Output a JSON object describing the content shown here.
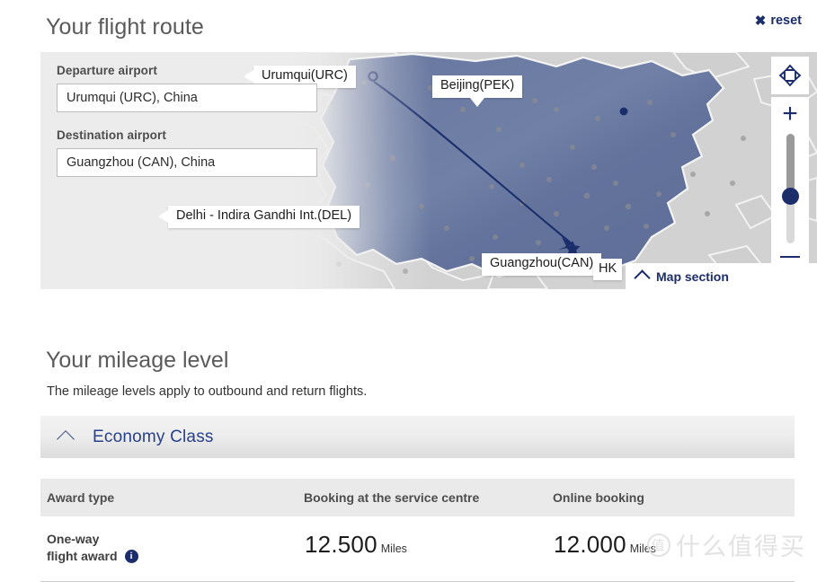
{
  "section_route": {
    "title": "Your flight route",
    "reset_label": "reset",
    "reset_icon": "close-x-icon",
    "departure": {
      "label": "Departure airport",
      "value": "Urumqui (URC), China",
      "placeholder": "Departure airport"
    },
    "destination": {
      "label": "Destination airport",
      "value": "Guangzhou (CAN), China",
      "placeholder": "Destination airport"
    }
  },
  "map": {
    "labels": [
      {
        "id": "urumqui",
        "text": "Urumqui(URC)"
      },
      {
        "id": "beijing",
        "text": "Beijing(PEK)"
      },
      {
        "id": "delhi",
        "text": "Delhi - Indira Gandhi Int.(DEL)"
      },
      {
        "id": "guangzhou",
        "text": "Guangzhou(CAN)"
      },
      {
        "id": "hongkong",
        "text": "HK"
      }
    ],
    "controls": {
      "pan_icon": "pan-arrows-icon",
      "zoom_in_icon": "plus-icon",
      "zoom_out_icon": "minus-icon",
      "zoom_slider": "zoom-slider"
    },
    "map_section": {
      "label": "Map section",
      "chevron": "chevron-up-icon"
    },
    "colors": {
      "country_fill": "#6373a0",
      "route_line": "#1b2d6b",
      "land": "#d0d0d0",
      "panel_bg": "#ececec"
    }
  },
  "section_mileage": {
    "title": "Your mileage level",
    "subtitle": "The mileage levels apply to outbound and return flights.",
    "class_section": {
      "label": "Economy Class",
      "chevron": "chevron-up-icon"
    },
    "table": {
      "headers": [
        "Award type",
        "Booking at the service centre",
        "Online booking"
      ],
      "rows": [
        {
          "award_type_line1": "One-way",
          "award_type_line2": "flight award",
          "info_icon": "info-icon",
          "service_centre_value": "12.500",
          "service_centre_unit": "Miles",
          "online_value": "12.000",
          "online_unit": "Miles"
        }
      ]
    }
  },
  "watermark": {
    "mark": "值",
    "text": "什么值得买"
  }
}
